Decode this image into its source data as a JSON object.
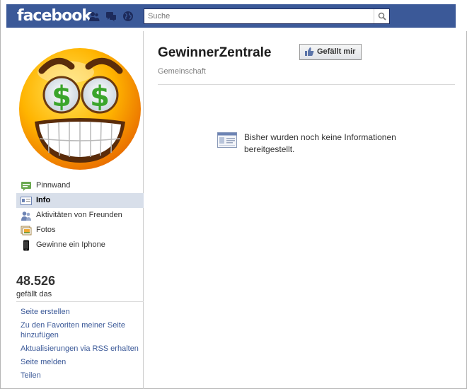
{
  "header": {
    "logo_text": "facebook",
    "search_placeholder": "Suche",
    "search_value": ""
  },
  "sidebar": {
    "nav_items": [
      {
        "label": "Pinnwand",
        "icon": "wall-icon",
        "selected": false
      },
      {
        "label": "Info",
        "icon": "info-icon",
        "selected": true
      },
      {
        "label": "Aktivitäten von Freunden",
        "icon": "friends-activity-icon",
        "selected": false
      },
      {
        "label": "Fotos",
        "icon": "photos-icon",
        "selected": false
      },
      {
        "label": "Gewinne ein Iphone",
        "icon": "phone-icon",
        "selected": false
      }
    ],
    "likes_count": "48.526",
    "likes_label": "gefällt das",
    "links": [
      "Seite erstellen",
      "Zu den Favoriten meiner Seite hinzufügen",
      "Aktualisierungen via RSS erhalten",
      "Seite melden",
      "Teilen"
    ]
  },
  "main": {
    "title": "GewinnerZentrale",
    "subtitle": "Gemeinschaft",
    "like_button_label": "Gefällt mir",
    "empty_message": "Bisher wurden noch keine Informationen bereitgestellt."
  },
  "colors": {
    "brand_blue": "#3b5998",
    "nav_selected": "#d8dfea",
    "link": "#3b5998"
  }
}
